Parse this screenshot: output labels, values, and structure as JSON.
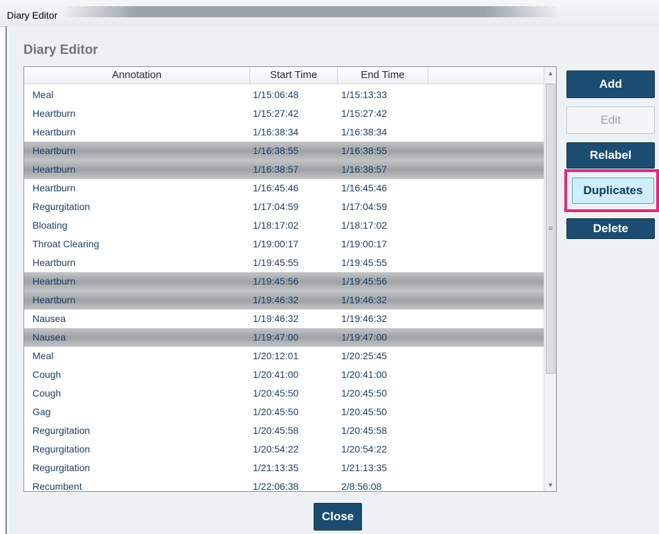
{
  "window": {
    "title": "Diary Editor"
  },
  "dialog": {
    "heading": "Diary Editor"
  },
  "table": {
    "columns": [
      "Annotation",
      "Start Time",
      "End Time"
    ],
    "rows": [
      {
        "annotation": "Meal",
        "start": "1/15:06:48",
        "end": "1/15:13:33",
        "selected": false
      },
      {
        "annotation": "Heartburn",
        "start": "1/15:27:42",
        "end": "1/15:27:42",
        "selected": false
      },
      {
        "annotation": "Heartburn",
        "start": "1/16:38:34",
        "end": "1/16:38:34",
        "selected": false
      },
      {
        "annotation": "Heartburn",
        "start": "1/16:38:55",
        "end": "1/16:38:55",
        "selected": true
      },
      {
        "annotation": "Heartburn",
        "start": "1/16:38:57",
        "end": "1/16:38:57",
        "selected": true
      },
      {
        "annotation": "Heartburn",
        "start": "1/16:45:46",
        "end": "1/16:45:46",
        "selected": false
      },
      {
        "annotation": "Regurgitation",
        "start": "1/17:04:59",
        "end": "1/17:04:59",
        "selected": false
      },
      {
        "annotation": "Bloating",
        "start": "1/18:17:02",
        "end": "1/18:17:02",
        "selected": false
      },
      {
        "annotation": "Throat Clearing",
        "start": "1/19:00:17",
        "end": "1/19:00:17",
        "selected": false
      },
      {
        "annotation": "Heartburn",
        "start": "1/19:45:55",
        "end": "1/19:45:55",
        "selected": false
      },
      {
        "annotation": "Heartburn",
        "start": "1/19:45:56",
        "end": "1/19:45:56",
        "selected": true
      },
      {
        "annotation": "Heartburn",
        "start": "1/19:46:32",
        "end": "1/19:46:32",
        "selected": true
      },
      {
        "annotation": "Nausea",
        "start": "1/19:46:32",
        "end": "1/19:46:32",
        "selected": false
      },
      {
        "annotation": "Nausea",
        "start": "1/19:47:00",
        "end": "1/19:47:00",
        "selected": true
      },
      {
        "annotation": "Meal",
        "start": "1/20:12:01",
        "end": "1/20:25:45",
        "selected": false
      },
      {
        "annotation": "Cough",
        "start": "1/20:41:00",
        "end": "1/20:41:00",
        "selected": false
      },
      {
        "annotation": "Cough",
        "start": "1/20:45:50",
        "end": "1/20:45:50",
        "selected": false
      },
      {
        "annotation": "Gag",
        "start": "1/20:45:50",
        "end": "1/20:45:50",
        "selected": false
      },
      {
        "annotation": "Regurgitation",
        "start": "1/20:45:58",
        "end": "1/20:45:58",
        "selected": false
      },
      {
        "annotation": "Regurgitation",
        "start": "1/20:54:22",
        "end": "1/20:54:22",
        "selected": false
      },
      {
        "annotation": "Regurgitation",
        "start": "1/21:13:35",
        "end": "1/21:13:35",
        "selected": false
      },
      {
        "annotation": "Recumbent",
        "start": "1/22:06:38",
        "end": "2/8:56:08",
        "selected": false
      }
    ]
  },
  "buttons": {
    "add": "Add",
    "edit": "Edit",
    "relabel": "Relabel",
    "duplicates": "Duplicates",
    "delete": "Delete",
    "close": "Close"
  },
  "scrollbar": {
    "up_icon": "▲",
    "down_icon": "▼",
    "grip_icon": "≡"
  },
  "colors": {
    "button_primary": "#1b4d72",
    "button_highlighted": "#cdeefa",
    "highlight_box": "#e6257a",
    "row_text": "#1d3f66",
    "row_selected": "#a8abae"
  }
}
